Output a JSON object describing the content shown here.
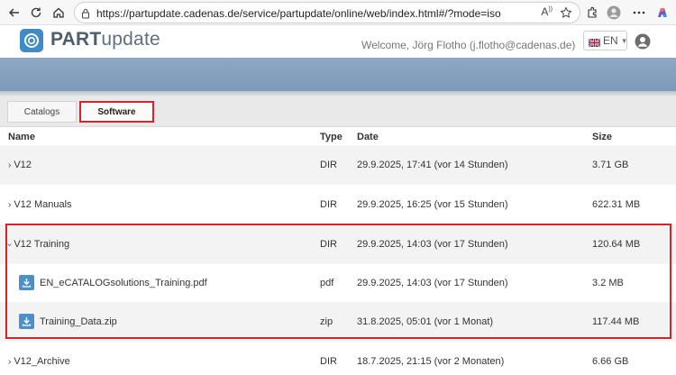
{
  "browser": {
    "url": "https://partupdate.cadenas.de/service/partupdate/online/web/index.html#/?mode=iso"
  },
  "header": {
    "brand_bold": "PART",
    "brand_rest": "update",
    "welcome": "Welcome, Jörg Flotho (j.flotho@cadenas.de)",
    "language": "EN"
  },
  "tabs": [
    {
      "label": "Catalogs",
      "active": false
    },
    {
      "label": "Software",
      "active": true
    }
  ],
  "table": {
    "columns": {
      "name": "Name",
      "type": "Type",
      "date": "Date",
      "size": "Size"
    },
    "rows": [
      {
        "name": "V12",
        "type": "DIR",
        "date": "29.9.2025, 17:41 (vor 14 Stunden)",
        "size": "3.71 GB",
        "kind": "folder",
        "expanded": false
      },
      {
        "name": "V12 Manuals",
        "type": "DIR",
        "date": "29.9.2025, 16:25 (vor 15 Stunden)",
        "size": "622.31 MB",
        "kind": "folder",
        "expanded": false
      },
      {
        "name": "V12 Training",
        "type": "DIR",
        "date": "29.9.2025, 14:03 (vor 17 Stunden)",
        "size": "120.64 MB",
        "kind": "folder",
        "expanded": true
      },
      {
        "name": "EN_eCATALOGsolutions_Training.pdf",
        "type": "pdf",
        "date": "29.9.2025, 14:03 (vor 17 Stunden)",
        "size": "3.2 MB",
        "kind": "file"
      },
      {
        "name": "Training_Data.zip",
        "type": "zip",
        "date": "31.8.2025, 05:01 (vor 1 Monat)",
        "size": "117.44 MB",
        "kind": "file"
      },
      {
        "name": "V12_Archive",
        "type": "DIR",
        "date": "18.7.2025, 21:15 (vor 2 Monaten)",
        "size": "6.66 GB",
        "kind": "folder",
        "expanded": false
      }
    ]
  },
  "colors": {
    "accent": "#3e8bc5",
    "highlight": "#d8232a",
    "banner": "#8fa8c3"
  }
}
